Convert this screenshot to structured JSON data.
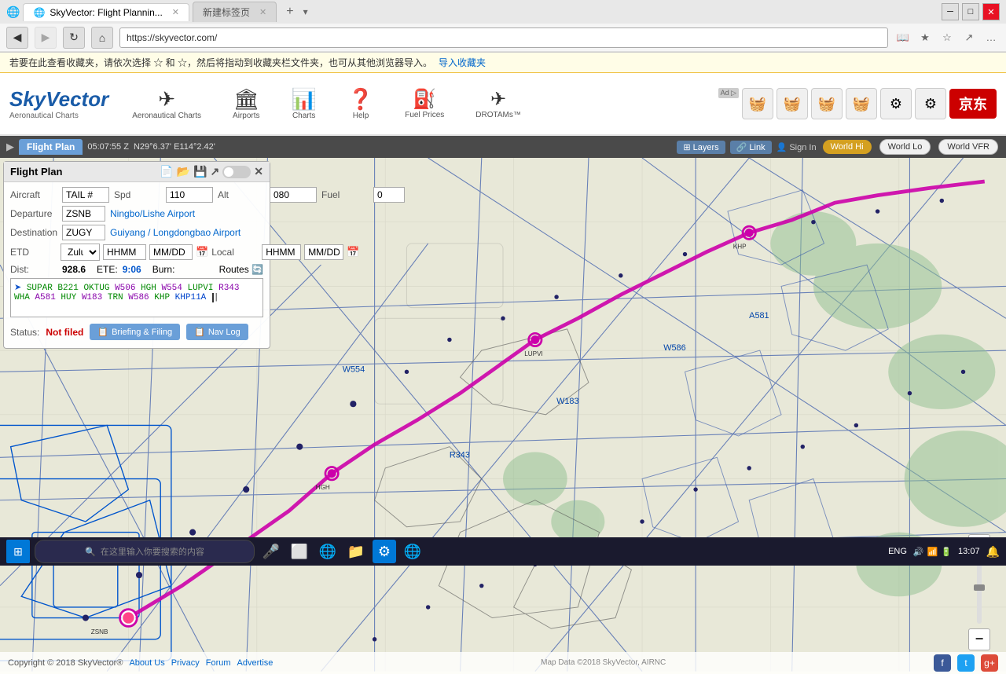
{
  "browser": {
    "tab_active": "SkyVector: Flight Plannin...",
    "tab_inactive": "新建标签页",
    "url": "https://skyvector.com/",
    "win_minimize": "─",
    "win_restore": "□",
    "win_close": "✕"
  },
  "notification": {
    "text": "若要在此查看收藏夹，请依次选择  ☆ 和 ☆，然后将指动到收藏夹栏文件夹，也可从其他浏览器导入。",
    "link_text": "导入收藏夹",
    "link_href": "#"
  },
  "header": {
    "logo_line1": "SkyVector",
    "logo_sub": "Aeronautical Charts",
    "nav_items": [
      {
        "id": "charts",
        "label": "Charts",
        "icon": "✈"
      },
      {
        "id": "airports",
        "label": "Airports",
        "icon": "🏛"
      },
      {
        "id": "charts2",
        "label": "Charts",
        "icon": "📊"
      },
      {
        "id": "help",
        "label": "Help",
        "icon": "❓"
      },
      {
        "id": "fuel",
        "label": "Fuel Prices",
        "icon": "⛽"
      },
      {
        "id": "drotams",
        "label": "DROTAMs™",
        "icon": "✈"
      }
    ]
  },
  "toolbar": {
    "flight_plan_tab": "Flight Plan",
    "coord": "05:07:55 Z",
    "coord2": "N29°6.37' E114°2.42'",
    "layers_label": "Layers",
    "link_label": "Link",
    "sign_in_label": "Sign In",
    "world_hi": "World Hi",
    "world_lo": "World Lo",
    "world_vfr": "World VFR"
  },
  "flight_plan": {
    "title": "Flight Plan",
    "aircraft_label": "Aircraft",
    "aircraft_value": "TAIL #",
    "spd_label": "Spd",
    "spd_value": "110",
    "alt_label": "Alt",
    "alt_value": "080",
    "fuel_label": "Fuel",
    "fuel_value": "0",
    "dep_label": "Departure",
    "dep_code": "ZSNB",
    "dep_name": "Ningbo/Lishe Airport",
    "dest_label": "Destination",
    "dest_code": "ZUGY",
    "dest_name": "Guiyang / Longdongbao Airport",
    "etd_label": "ETD",
    "etd_zulu": "Zulu",
    "etd_hhmm": "HHMM",
    "etd_date": "MM/DD",
    "local_label": "Local",
    "local_hhmm": "HHMM",
    "local_date": "MM/DD",
    "dist_label": "Dist:",
    "dist_value": "928.6",
    "ete_label": "ETE:",
    "ete_value": "9:06",
    "burn_label": "Burn:",
    "routes_label": "Routes",
    "route_text": "SUPAR B221 OKTUG W506 HGH W554 LUPVI R343 WHA A581 HUY W183 TRN W586 KHP KHP11A",
    "status_label": "Status:",
    "status_value": "Not filed",
    "briefing_label": "Briefing & Filing",
    "navlog_label": "Nav Log"
  },
  "map": {
    "bg_color": "#e8e8d8"
  },
  "copyright": {
    "text": "Copyright © 2018 SkyVector®",
    "about": "About Us",
    "privacy": "Privacy",
    "forum": "Forum",
    "advertise": "Advertise",
    "map_data": "Map Data ©2018 SkyVector, AIRNC"
  },
  "taskbar": {
    "time": "13:07",
    "date": "",
    "lang": "ENG",
    "search_placeholder": "在这里输入你要搜索的内容"
  },
  "ads": {
    "ad_label": "Ad ▷",
    "store_label": "京东",
    "icons": [
      "🧺",
      "🧺",
      "🧺",
      "🧺",
      "⚙",
      "⚙"
    ]
  }
}
